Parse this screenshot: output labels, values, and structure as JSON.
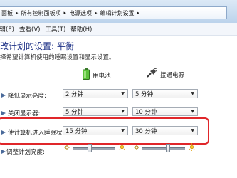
{
  "address_bar": {
    "crumbs": [
      "面板",
      "所有控制面板项",
      "电源选项",
      "编辑计划设置"
    ]
  },
  "menu": {
    "items": [
      "编辑(E)",
      "查看(V)",
      "工具(T)",
      "帮助(H)"
    ]
  },
  "page": {
    "title": "改计划的设置: 平衡",
    "subtitle": "择希望计算机使用的睡眠设置和显示设置。"
  },
  "columns": {
    "battery": "用电池",
    "plugged": "接通电源"
  },
  "rows": {
    "dim": {
      "label": "降低显示亮度:",
      "battery": "2 分钟",
      "plugged": "5 分钟"
    },
    "display_off": {
      "label": "关闭显示器:",
      "battery": "5 分钟",
      "plugged": "10 分钟"
    },
    "sleep": {
      "label": "使计算机进入睡眠状态:",
      "battery": "15 分钟",
      "plugged": "30 分钟"
    },
    "brightness": {
      "label": "调整计划亮度:",
      "battery_level": 0.4,
      "plugged_level": 0.6
    }
  },
  "icons": {
    "battery": "battery-icon",
    "plug": "power-plug-icon",
    "row_arrow": "row-arrow-icon",
    "sun_dim": "sun-dim-icon",
    "sun_bright": "sun-bright-icon"
  },
  "colors": {
    "title": "#1e3287",
    "highlight": "#e0262a"
  }
}
